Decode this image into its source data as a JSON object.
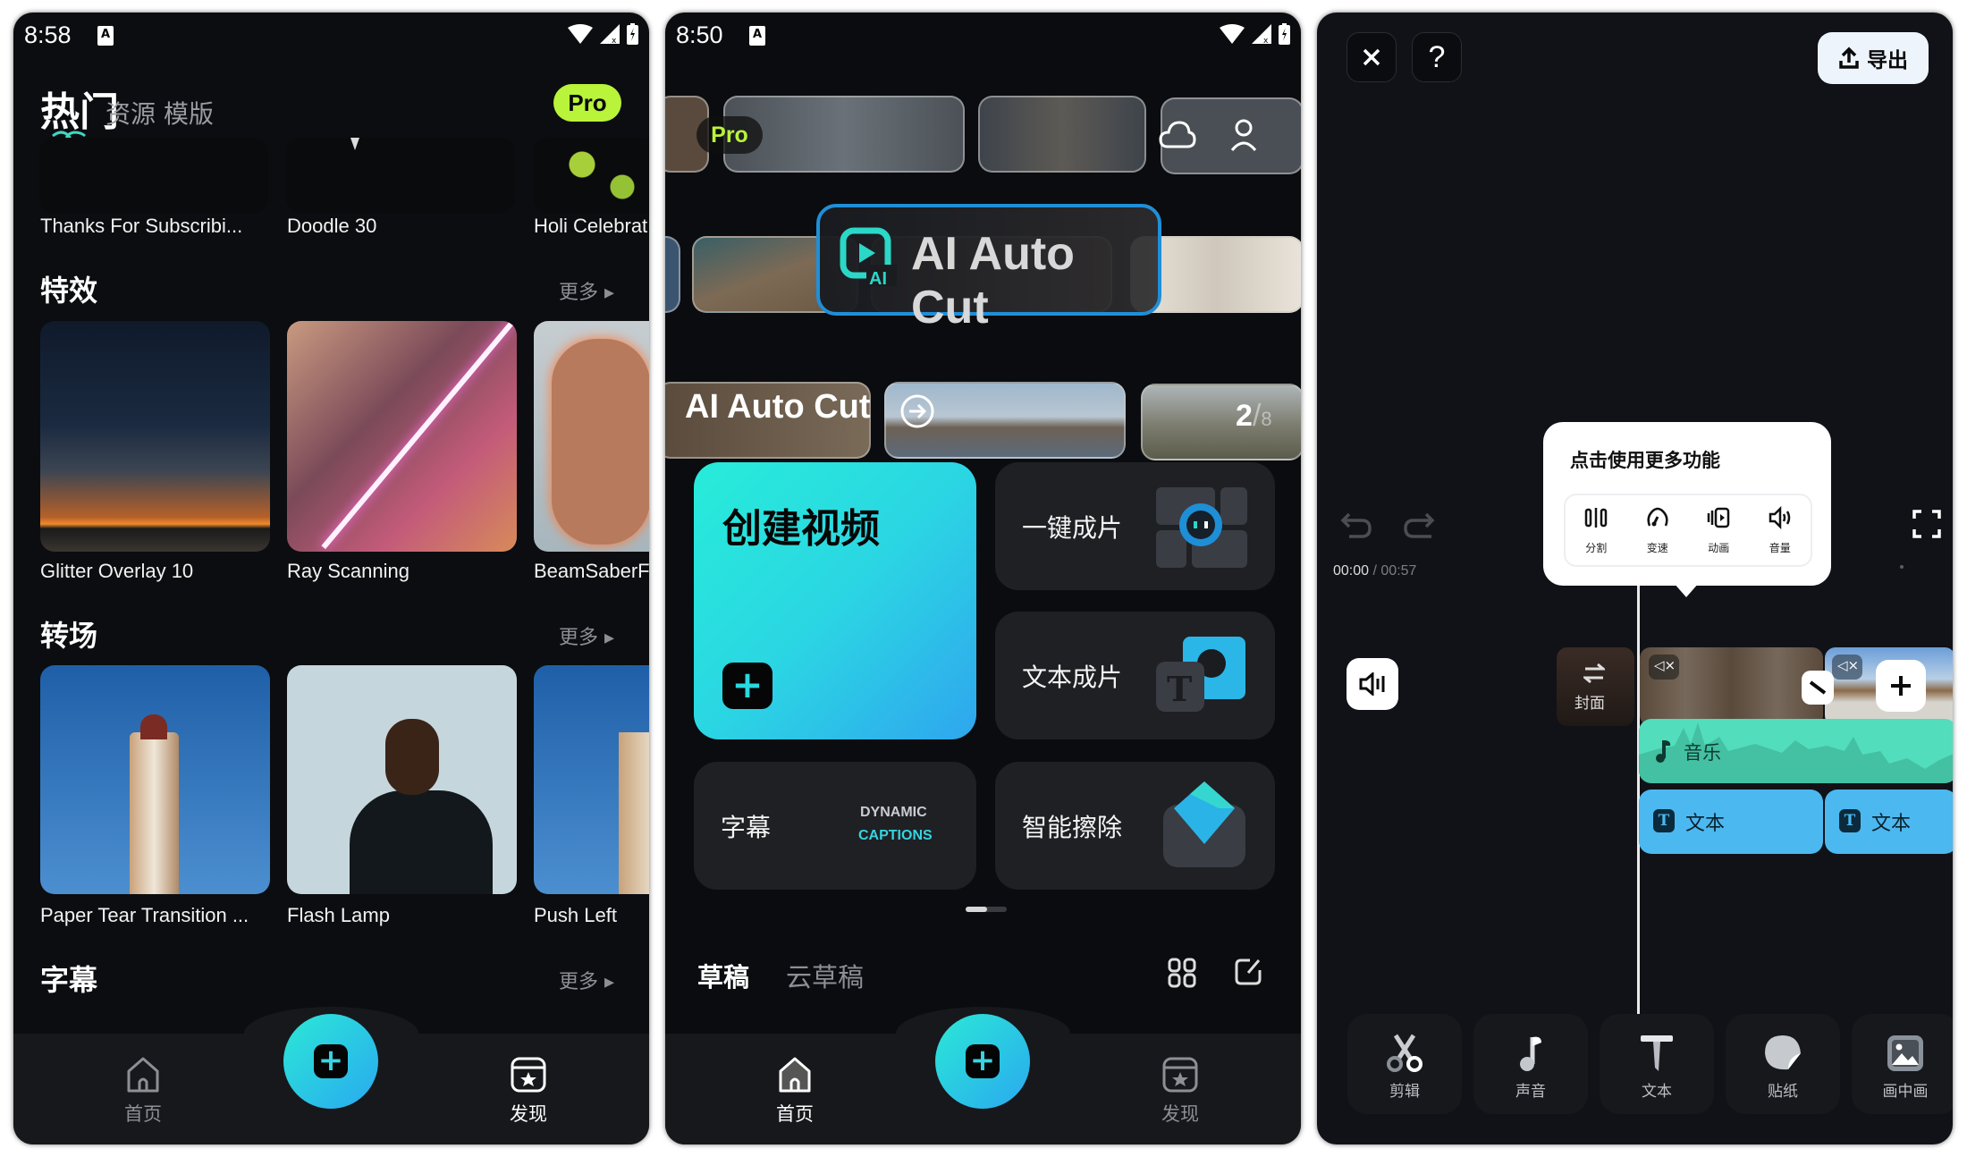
{
  "screens": [
    {
      "status": {
        "time": "8:58",
        "notification": "A"
      },
      "tabs": [
        {
          "label": "热门",
          "active": true
        },
        {
          "label": "资源",
          "active": false
        },
        {
          "label": "模版",
          "active": false
        }
      ],
      "pro_badge": "Pro",
      "top_row": [
        "Thanks For Subscribi...",
        "Doodle 30",
        "Holi Celebrat"
      ],
      "sections": [
        {
          "title": "特效",
          "more": "更多",
          "items": [
            "Glitter Overlay 10",
            "Ray Scanning",
            "BeamSaberF"
          ]
        },
        {
          "title": "转场",
          "more": "更多",
          "items": [
            "Paper Tear Transition ...",
            "Flash Lamp",
            "Push Left"
          ]
        },
        {
          "title": "字幕",
          "more": "更多",
          "items": []
        }
      ],
      "nav": {
        "home": "首页",
        "discover": "发现",
        "active": "discover"
      }
    },
    {
      "status": {
        "time": "8:50",
        "notification": "A"
      },
      "pro_badge": "Pro",
      "banner": {
        "title": "AI Auto Cut",
        "subtitle": "AI Auto Cut",
        "page_current": "2",
        "page_total": "8"
      },
      "create": {
        "label": "创建视频"
      },
      "tiles": [
        {
          "label": "一键成片",
          "icon": "robot-icon"
        },
        {
          "label": "文本成片",
          "icon": "text-to-video-icon"
        },
        {
          "label": "字幕",
          "art_line1": "DYNAMIC",
          "art_line2": "CAPTIONS"
        },
        {
          "label": "智能擦除",
          "icon": "eraser-icon"
        }
      ],
      "drafts": {
        "tab_local": "草稿",
        "tab_cloud": "云草稿",
        "active": "local"
      },
      "nav": {
        "home": "首页",
        "discover": "发现",
        "active": "home"
      }
    },
    {
      "export_label": "导出",
      "tooltip": {
        "title": "点击使用更多功能",
        "items": [
          {
            "label": "分割",
            "icon": "split-icon"
          },
          {
            "label": "变速",
            "icon": "speed-icon"
          },
          {
            "label": "动画",
            "icon": "animation-icon"
          },
          {
            "label": "音量",
            "icon": "volume-icon"
          }
        ]
      },
      "timecode": {
        "current": "00:00",
        "separator": " / ",
        "total": "00:57"
      },
      "cover_label": "封面",
      "music_label": "音乐",
      "text_tracks": [
        "文本",
        "文本"
      ],
      "tools": [
        {
          "label": "剪辑",
          "icon": "scissors-icon"
        },
        {
          "label": "声音",
          "icon": "music-note-icon"
        },
        {
          "label": "文本",
          "icon": "text-icon"
        },
        {
          "label": "贴纸",
          "icon": "sticker-icon"
        },
        {
          "label": "画中画",
          "icon": "picture-in-picture-icon"
        }
      ]
    }
  ],
  "colors": {
    "pro": "#b9f33a",
    "accent_teal": "#2be8d6",
    "accent_blue": "#2aa9f0",
    "music_track": "#52ddbc",
    "text_track": "#4cb8f0",
    "banner_border": "#1f8fd8"
  }
}
